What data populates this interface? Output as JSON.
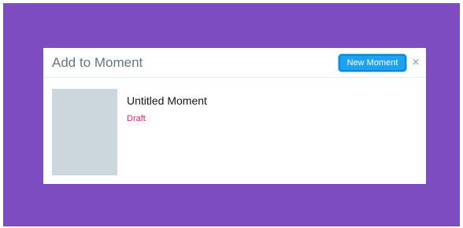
{
  "dialog": {
    "title": "Add to Moment",
    "new_moment_label": "New Moment",
    "close_icon": "close-icon",
    "close_glyph": "×"
  },
  "moments": [
    {
      "title": "Untitled Moment",
      "status": "Draft",
      "thumbnail": "placeholder"
    }
  ],
  "colors": {
    "backdrop": "#7c4cc0",
    "accent": "#1da1f2",
    "draft": "#e0245e",
    "thumbnail_placeholder": "#ccd6dd"
  }
}
